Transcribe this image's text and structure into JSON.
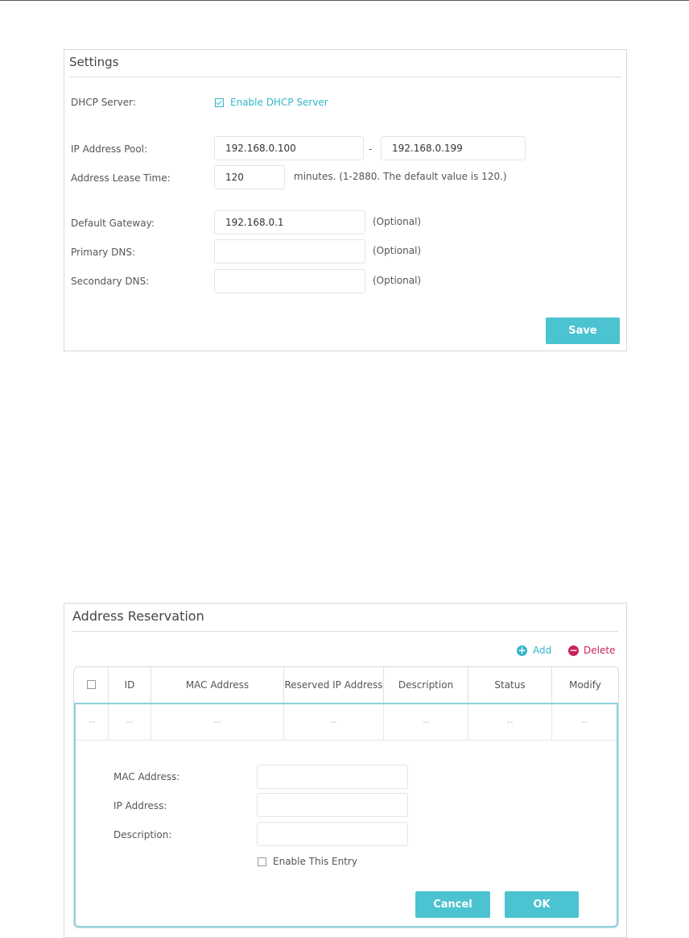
{
  "settings": {
    "title": "Settings",
    "dhcp_server_label": "DHCP Server:",
    "enable_dhcp_label": "Enable DHCP Server",
    "enable_dhcp_checked": true,
    "ip_pool_label": "IP Address Pool:",
    "ip_pool_start": "192.168.0.100",
    "ip_pool_separator": "-",
    "ip_pool_end": "192.168.0.199",
    "lease_time_label": "Address Lease Time:",
    "lease_time_value": "120",
    "lease_time_hint": "minutes. (1-2880. The default value is 120.)",
    "default_gateway_label": "Default Gateway:",
    "default_gateway_value": "192.168.0.1",
    "primary_dns_label": "Primary DNS:",
    "primary_dns_value": "",
    "secondary_dns_label": "Secondary DNS:",
    "secondary_dns_value": "",
    "optional_hint": "(Optional)",
    "save_label": "Save"
  },
  "reservation": {
    "title": "Address Reservation",
    "add_label": "Add",
    "delete_label": "Delete",
    "columns": [
      "ID",
      "MAC Address",
      "Reserved IP Address",
      "Description",
      "Status",
      "Modify"
    ],
    "row_placeholder": "--",
    "form": {
      "mac_label": "MAC Address:",
      "mac_value": "",
      "ip_label": "IP Address:",
      "ip_value": "",
      "description_label": "Description:",
      "description_value": "",
      "enable_entry_label": "Enable This Entry",
      "enable_entry_checked": false,
      "cancel_label": "Cancel",
      "ok_label": "OK"
    }
  },
  "colors": {
    "accent": "#4cc3d1",
    "link": "#33b6c8",
    "delete": "#c8245a"
  }
}
